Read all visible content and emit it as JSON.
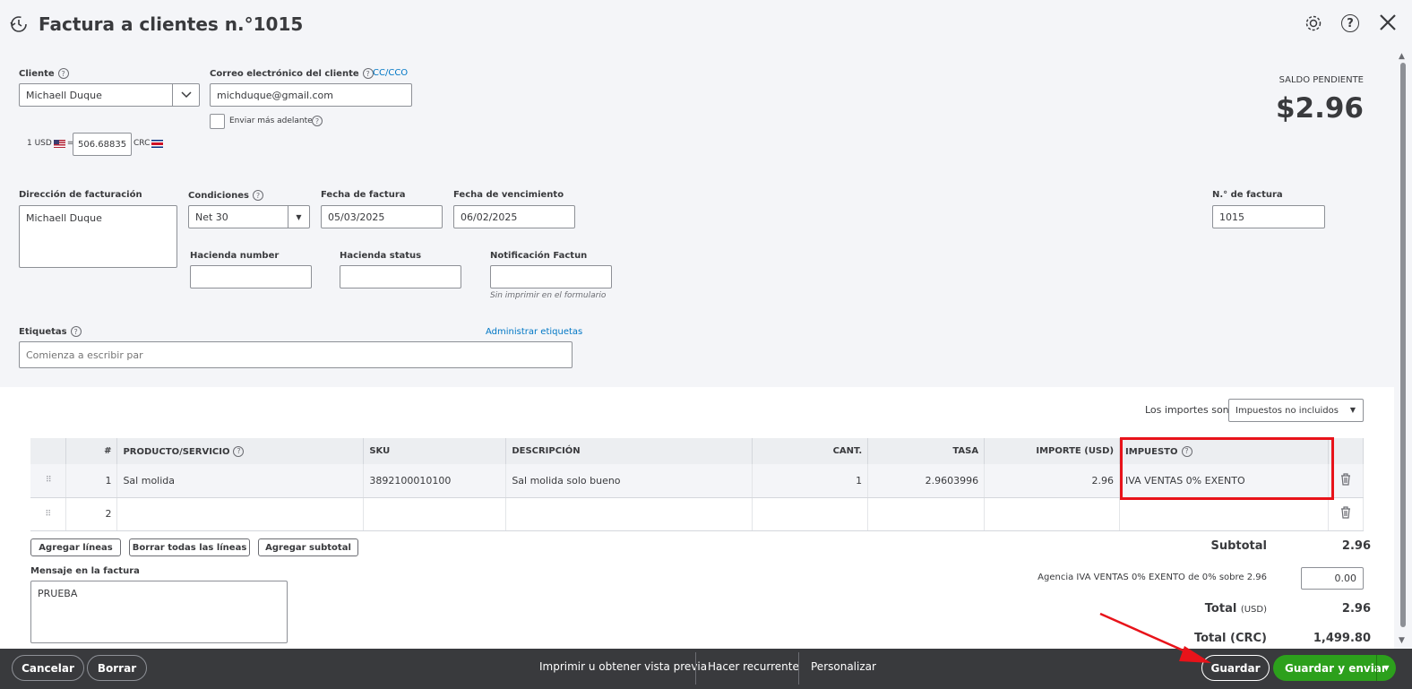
{
  "header": {
    "title": "Factura a clientes n.°1015"
  },
  "customer": {
    "label": "Cliente",
    "value": "Michaell Duque",
    "email_label": "Correo electrónico del cliente",
    "cc_link": "CC/CCO",
    "email_value": "michduque@gmail.com",
    "send_later_label": "Enviar más adelante"
  },
  "exchange": {
    "from": "1 USD",
    "equals": "=",
    "rate": "506.68835",
    "to": "CRC"
  },
  "balance": {
    "label": "SALDO PENDIENTE",
    "amount": "$2.96"
  },
  "billing": {
    "address_label": "Dirección de facturación",
    "address_value": "Michaell Duque",
    "terms_label": "Condiciones",
    "terms_value": "Net 30",
    "invoice_date_label": "Fecha de factura",
    "invoice_date_value": "05/03/2025",
    "due_date_label": "Fecha de vencimiento",
    "due_date_value": "06/02/2025",
    "invoice_no_label": "N.° de factura",
    "invoice_no_value": "1015"
  },
  "custom_fields": {
    "hacienda_number_label": "Hacienda number",
    "hacienda_status_label": "Hacienda status",
    "notificacion_label": "Notificación Factun",
    "notificacion_hint": "Sin imprimir en el formulario"
  },
  "tags": {
    "label": "Etiquetas",
    "manage_link": "Administrar etiquetas",
    "placeholder": "Comienza a escribir par"
  },
  "amounts": {
    "label": "Los importes son",
    "value": "Impuestos no incluidos"
  },
  "table": {
    "headers": [
      "#",
      "PRODUCTO/SERVICIO",
      "SKU",
      "DESCRIPCIÓN",
      "CANT.",
      "TASA",
      "IMPORTE (USD)",
      "IMPUESTO"
    ],
    "rows": [
      {
        "num": "1",
        "product": "Sal molida",
        "sku": "3892100010100",
        "description": "Sal molida solo bueno",
        "qty": "1",
        "rate": "2.9603996",
        "amount": "2.96",
        "tax": "IVA VENTAS 0% EXENTO"
      },
      {
        "num": "2",
        "product": "",
        "sku": "",
        "description": "",
        "qty": "",
        "rate": "",
        "amount": "",
        "tax": ""
      }
    ]
  },
  "line_buttons": {
    "add_lines": "Agregar líneas",
    "clear_lines": "Borrar todas las líneas",
    "add_subtotal": "Agregar subtotal"
  },
  "message": {
    "label": "Mensaje en la factura",
    "value": "PRUEBA"
  },
  "totals": {
    "subtotal_label": "Subtotal",
    "subtotal_value": "2.96",
    "tax_label": "Agencia IVA VENTAS 0% EXENTO de 0% sobre 2.96",
    "tax_value": "0.00",
    "total_label": "Total",
    "total_unit": "(USD)",
    "total_value": "2.96",
    "total_crc_label": "Total (CRC)",
    "total_crc_value": "1,499.80"
  },
  "footer": {
    "cancel": "Cancelar",
    "clear": "Borrar",
    "print": "Imprimir u obtener vista previa",
    "recurring": "Hacer recurrente",
    "customize": "Personalizar",
    "save": "Guardar",
    "save_send": "Guardar y enviar"
  },
  "colors": {
    "accent_green": "#2ca01c",
    "link_blue": "#0077c5",
    "annotation_red": "#e8131a",
    "footer_bg": "#393a3d"
  }
}
